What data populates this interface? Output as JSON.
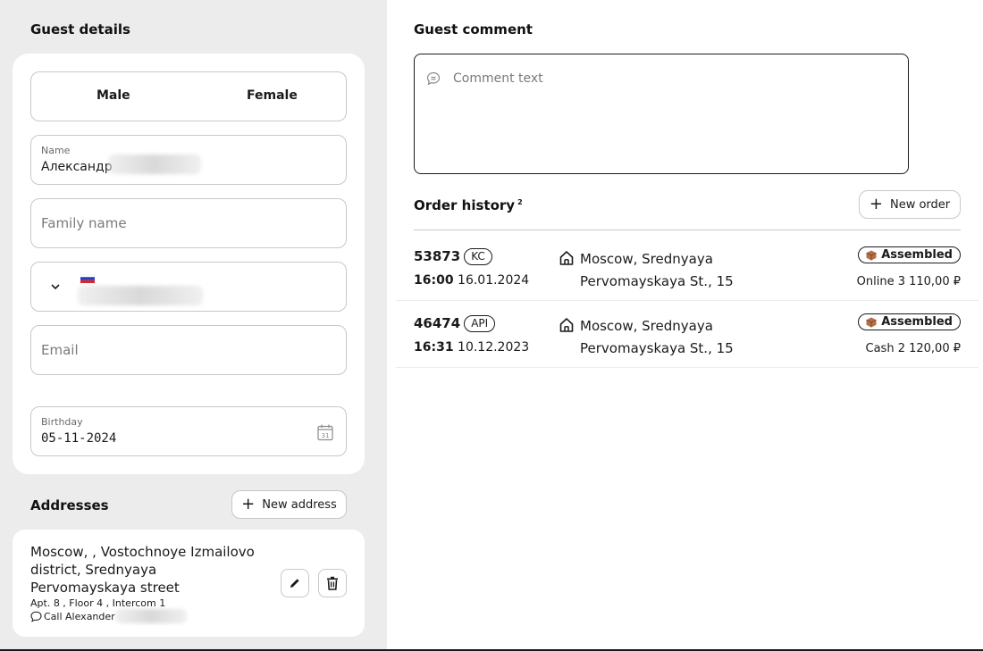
{
  "guest_details": {
    "title": "Guest details",
    "gender": {
      "male": "Male",
      "female": "Female"
    },
    "name": {
      "label": "Name",
      "value": "Александр"
    },
    "family_name": {
      "placeholder": "Family name"
    },
    "email": {
      "placeholder": "Email"
    },
    "birthday": {
      "label": "Birthday",
      "value": "05-11-2024",
      "calendar_day": "31"
    }
  },
  "addresses": {
    "title": "Addresses",
    "new_button": "New address",
    "items": [
      {
        "street": "Moscow, , Vostochnoye Izmailovo district, Srednyaya Pervomayskaya street",
        "details": "Apt. 8 , Floor 4 , Intercom 1",
        "note": "Call Alexander"
      }
    ]
  },
  "guest_comment": {
    "title": "Guest comment",
    "placeholder": "Comment text"
  },
  "order_history": {
    "title": "Order history",
    "count": "2",
    "new_button": "New order",
    "orders": [
      {
        "number": "53873",
        "source": "KC",
        "time": "16:00",
        "date": "16.01.2024",
        "address_line1": "Moscow, Srednyaya",
        "address_line2": "Pervomayskaya St., 15",
        "status": "Assembled",
        "payment": "Online 3 110,00 ₽"
      },
      {
        "number": "46474",
        "source": "API",
        "time": "16:31",
        "date": "10.12.2023",
        "address_line1": "Moscow, Srednyaya",
        "address_line2": "Pervomayskaya St., 15",
        "status": "Assembled",
        "payment": "Cash 2 120,00 ₽"
      }
    ]
  },
  "colors": {
    "left_panel_bg": "#ececec",
    "border": "#c8c8c8",
    "text": "#1a1a1a",
    "status_icon": "#b5704a"
  }
}
